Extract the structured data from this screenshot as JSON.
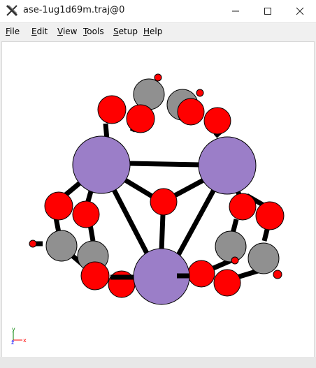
{
  "window": {
    "title": "ase-1ug1d69m.traj@0",
    "icon": "x-icon",
    "controls": [
      "minimize-icon",
      "maximize-icon",
      "close-icon"
    ]
  },
  "menu": {
    "items": [
      {
        "label": "File",
        "acc": "F",
        "rest": "ile"
      },
      {
        "label": "Edit",
        "acc": "E",
        "rest": "dit"
      },
      {
        "label": "View",
        "acc": "V",
        "rest": "iew"
      },
      {
        "label": "Tools",
        "acc": "T",
        "rest": "ools"
      },
      {
        "label": "Setup",
        "acc": "S",
        "rest": "etup"
      },
      {
        "label": "Help",
        "acc": "H",
        "rest": "elp"
      }
    ]
  },
  "viewer": {
    "axes": {
      "x": "x",
      "y": "y",
      "z": "z"
    },
    "colors": {
      "metal": "#9b7ec8",
      "oxygen": "#ff0000",
      "carbon": "#909090",
      "bond": "#000000",
      "x_axis": "#ff0000",
      "y_axis": "#008000",
      "z_axis": "#0000ff"
    }
  }
}
